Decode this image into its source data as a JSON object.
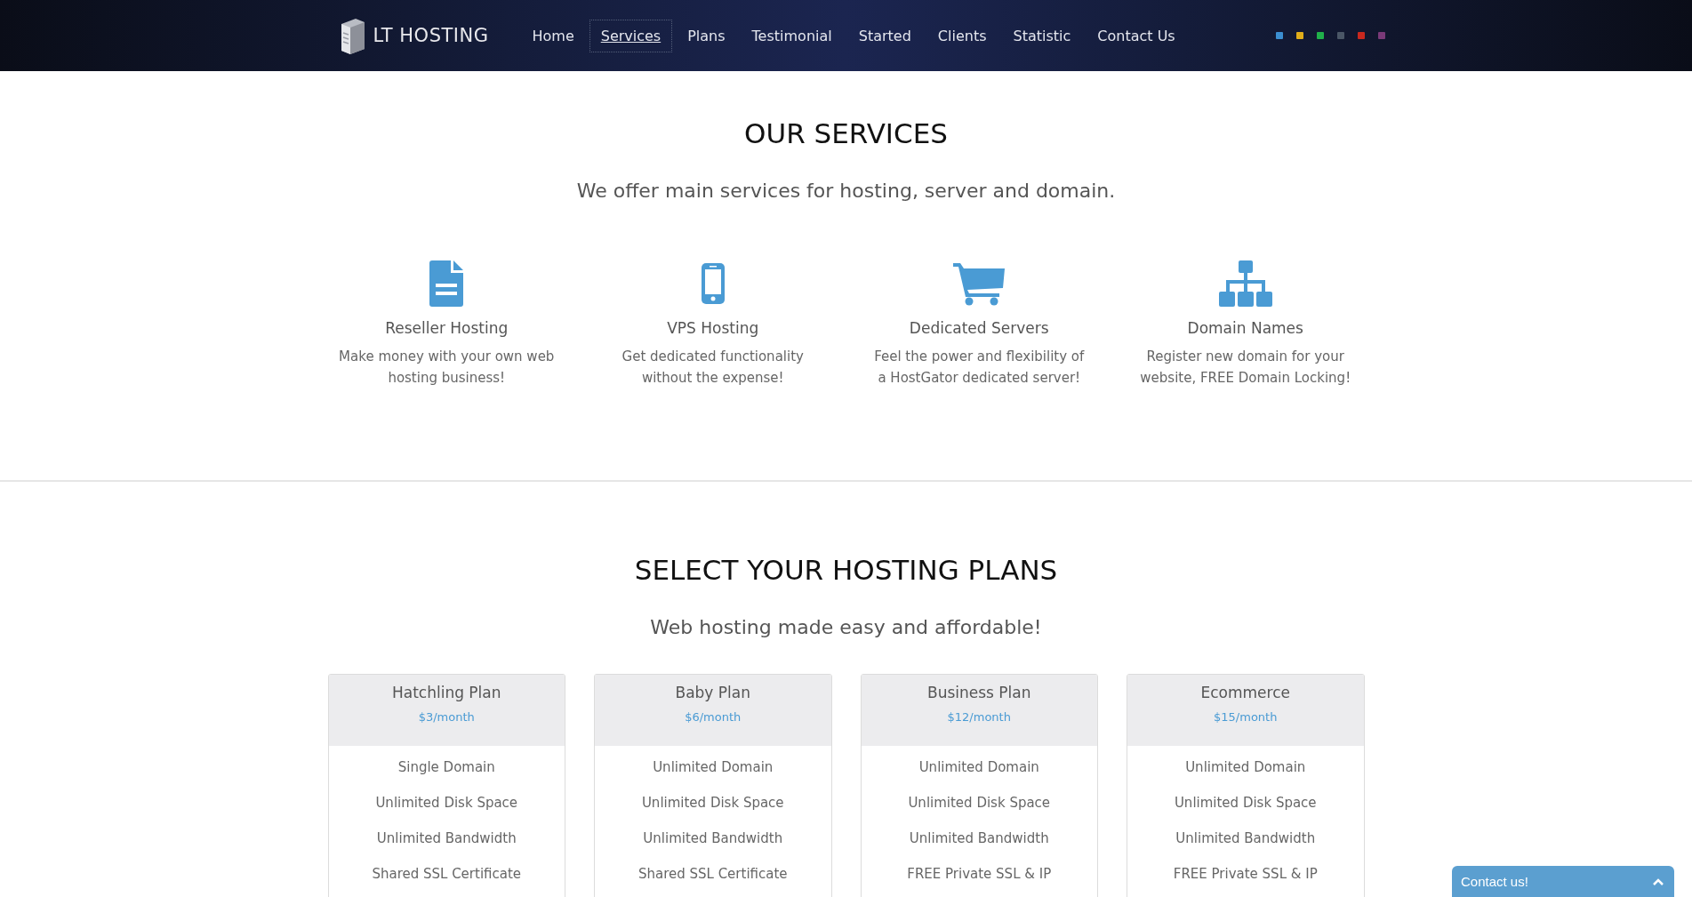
{
  "header": {
    "logo": "LT HOSTING",
    "nav": [
      {
        "label": "Home",
        "selected": false
      },
      {
        "label": "Services",
        "selected": true
      },
      {
        "label": "Plans",
        "selected": false
      },
      {
        "label": "Testimonial",
        "selected": false
      },
      {
        "label": "Started",
        "selected": false
      },
      {
        "label": "Clients",
        "selected": false
      },
      {
        "label": "Statistic",
        "selected": false
      },
      {
        "label": "Contact Us",
        "selected": false
      }
    ],
    "color_swatches": [
      {
        "color": "#3b8ed0"
      },
      {
        "color": "#e0ad1a"
      },
      {
        "color": "#20b04a"
      },
      {
        "color": "#4a5666"
      },
      {
        "color": "#c8281e"
      },
      {
        "color": "#7a3a78"
      }
    ]
  },
  "services": {
    "title": "OUR SERVICES",
    "subtitle": "We offer main services for hosting, server and domain.",
    "items": [
      {
        "kind": "document",
        "title": "Reseller Hosting",
        "text": "Make money with your own web hosting business!"
      },
      {
        "kind": "phone",
        "title": "VPS Hosting",
        "text": "Get dedicated functionality without the expense!"
      },
      {
        "kind": "cart",
        "title": "Dedicated Servers",
        "text": "Feel the power and flexibility of a HostGator dedicated server!"
      },
      {
        "kind": "sitemap",
        "title": "Domain Names",
        "text": "Register new domain for your website, FREE Domain Locking!"
      }
    ]
  },
  "plans": {
    "title": "SELECT YOUR HOSTING PLANS",
    "subtitle": "Web hosting made easy and affordable!",
    "items": [
      {
        "name": "Hatchling Plan",
        "price": "$3/month",
        "features": [
          "Single Domain",
          "Unlimited Disk Space",
          "Unlimited Bandwidth",
          "Shared SSL Certificate"
        ]
      },
      {
        "name": "Baby Plan",
        "price": "$6/month",
        "features": [
          "Unlimited Domain",
          "Unlimited Disk Space",
          "Unlimited Bandwidth",
          "Shared SSL Certificate"
        ]
      },
      {
        "name": "Business Plan",
        "price": "$12/month",
        "features": [
          "Unlimited Domain",
          "Unlimited Disk Space",
          "Unlimited Bandwidth",
          "FREE Private SSL & IP"
        ]
      },
      {
        "name": "Ecommerce",
        "price": "$15/month",
        "features": [
          "Unlimited Domain",
          "Unlimited Disk Space",
          "Unlimited Bandwidth",
          "FREE Private SSL & IP"
        ]
      }
    ]
  },
  "contact_widget": {
    "label": "Contact us!"
  }
}
